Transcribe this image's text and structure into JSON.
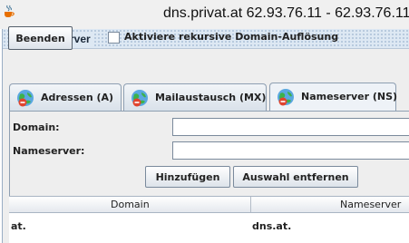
{
  "os_window": {
    "title": "dns.privat.at 62.93.76.11 - 62.93.76.11",
    "icon": "java-cup-icon"
  },
  "app": {
    "title": "DNS-Server",
    "icon": "dns-app-icon"
  },
  "toolbar": {
    "exit_label": "Beenden",
    "recursive_checkbox_label": "Aktiviere rekursive Domain-Auflösung",
    "recursive_checked": false
  },
  "tabs": [
    {
      "label": "Adressen (A)",
      "icon": "globe-icon",
      "selected": false
    },
    {
      "label": "Mailaustausch (MX)",
      "icon": "globe-icon",
      "selected": false
    },
    {
      "label": "Nameserver (NS)",
      "icon": "globe-icon",
      "selected": true
    }
  ],
  "form": {
    "domain_label": "Domain:",
    "domain_value": "",
    "nameserver_label": "Nameserver:",
    "nameserver_value": "",
    "add_label": "Hinzufügen",
    "remove_label": "Auswahl entfernen"
  },
  "table": {
    "columns": [
      "Domain",
      "Nameserver"
    ],
    "rows": [
      [
        "at.",
        "dns.at."
      ]
    ]
  },
  "colors": {
    "accent": "#dde8f3",
    "globe": "#5aa8e0",
    "globe_land": "#3cb24a",
    "no_entry": "#e0442e"
  }
}
